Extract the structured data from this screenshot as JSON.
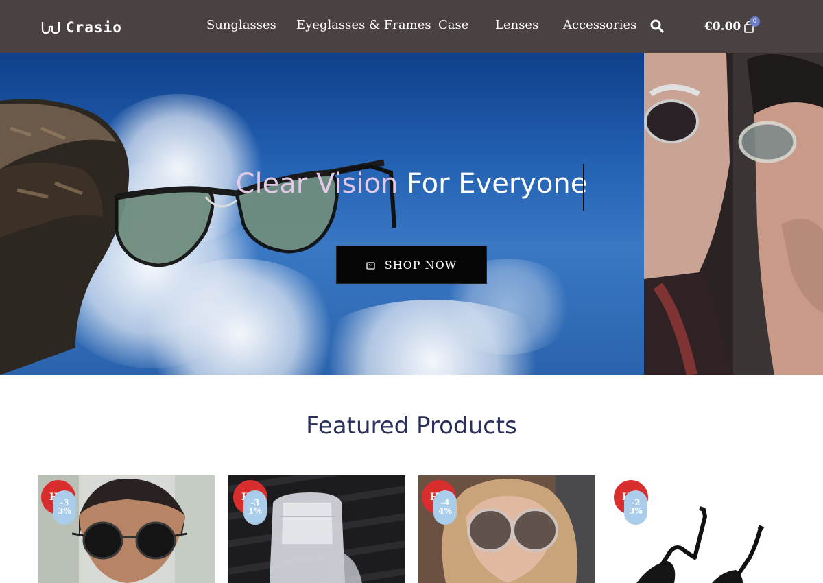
{
  "header": {
    "logo_text": "Crasio",
    "nav": [
      {
        "label": "Sunglasses"
      },
      {
        "label": "Eyeglasses & Frames"
      },
      {
        "label": "Case"
      },
      {
        "label": "Lenses"
      },
      {
        "label": "Accessories"
      }
    ],
    "search_icon": "search-icon",
    "cart_total": "€0.00",
    "cart_count": "0",
    "cart_icon": "shopping-bag-icon"
  },
  "hero": {
    "title_faded": "Clear Vision",
    "title_rest": " For Everyone",
    "button_label": "SHOP NOW",
    "button_icon": "shopping-bag-icon"
  },
  "featured": {
    "title": "Featured Products",
    "products": [
      {
        "sale_label": "H",
        "discount_top": "-3",
        "discount_bottom": "3%"
      },
      {
        "sale_label": "H",
        "discount_top": "-3",
        "discount_bottom": "1%"
      },
      {
        "sale_label": "H",
        "discount_top": "-4",
        "discount_bottom": "4%"
      },
      {
        "sale_label": "H",
        "discount_top": "-2",
        "discount_bottom": "3%"
      }
    ]
  },
  "colors": {
    "header_bg": "#4a4242",
    "sale_badge": "#d92e2e",
    "discount_badge": "#a9cdea",
    "heading": "#2b2f5c",
    "cart_badge": "#6c7ec9"
  }
}
